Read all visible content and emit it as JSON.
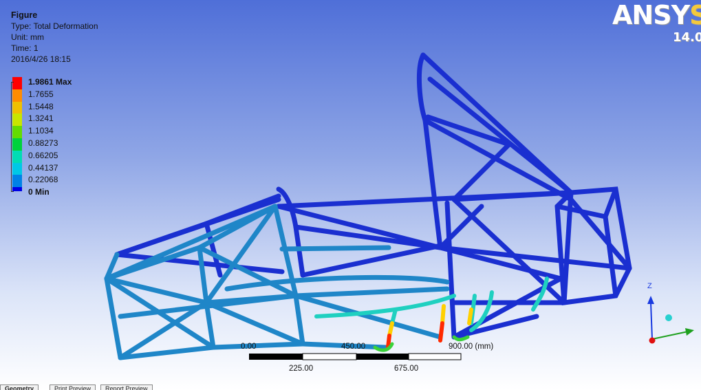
{
  "info": {
    "title": "Figure",
    "type": "Type: Total Deformation",
    "unit": "Unit: mm",
    "time": "Time: 1",
    "date": "2016/4/26 18:15"
  },
  "legend": {
    "entries": [
      {
        "label": "1.9861 Max",
        "color": "#ff0000",
        "bold": true
      },
      {
        "label": "1.7655",
        "color": "#ff8c00"
      },
      {
        "label": "1.5448",
        "color": "#f0c000"
      },
      {
        "label": "1.3241",
        "color": "#c8e600"
      },
      {
        "label": "1.1034",
        "color": "#64dc00"
      },
      {
        "label": "0.88273",
        "color": "#00d23c"
      },
      {
        "label": "0.66205",
        "color": "#00dcb4"
      },
      {
        "label": "0.44137",
        "color": "#00c8e6"
      },
      {
        "label": "0.22068",
        "color": "#0082e6"
      },
      {
        "label": "0 Min",
        "color": "#0000e6",
        "bold": true
      }
    ]
  },
  "logo": {
    "text_main": "ANSYS",
    "version": "14.0"
  },
  "scale": {
    "top_labels": [
      "0.00",
      "450.00",
      "900.00 (mm)"
    ],
    "bottom_labels": [
      "225.00",
      "675.00"
    ]
  },
  "axes": {
    "z_label": "Z"
  },
  "tabs": [
    "Geometry",
    "Print Preview",
    "Report Preview"
  ]
}
